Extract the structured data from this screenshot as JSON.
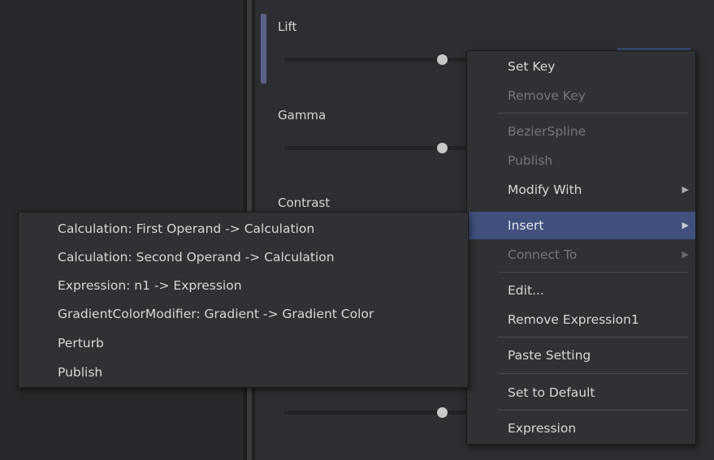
{
  "params": {
    "lift": "Lift",
    "gamma": "Gamma",
    "contrast": "Contrast"
  },
  "context_menu": {
    "items": [
      {
        "label": "Set Key",
        "enabled": true
      },
      {
        "label": "Remove Key",
        "enabled": false
      },
      {
        "label": "BezierSpline",
        "enabled": false
      },
      {
        "label": "Publish",
        "enabled": false
      },
      {
        "label": "Modify With",
        "enabled": true,
        "submenu": true
      },
      {
        "label": "Insert",
        "enabled": true,
        "submenu": true,
        "selected": true
      },
      {
        "label": "Connect To",
        "enabled": false,
        "submenu": true
      },
      {
        "label": "Edit...",
        "enabled": true
      },
      {
        "label": "Remove Expression1",
        "enabled": true
      },
      {
        "label": "Paste Setting",
        "enabled": true
      },
      {
        "label": "Set to Default",
        "enabled": true
      },
      {
        "label": "Expression",
        "enabled": true
      }
    ]
  },
  "insert_submenu": {
    "items": [
      "Calculation: First Operand -> Calculation",
      "Calculation: Second Operand -> Calculation",
      "Expression: n1 -> Expression",
      "GradientColorModifier: Gradient -> Gradient Color",
      "Perturb",
      "Publish"
    ]
  },
  "icons": {
    "submenu_arrow": "triangle-right-icon"
  },
  "colors": {
    "background": "#2d2e32",
    "menu_bg": "#303135",
    "selected_bg": "#41507d",
    "accent_bar": "#5a6289",
    "disabled_text": "#76777b"
  }
}
